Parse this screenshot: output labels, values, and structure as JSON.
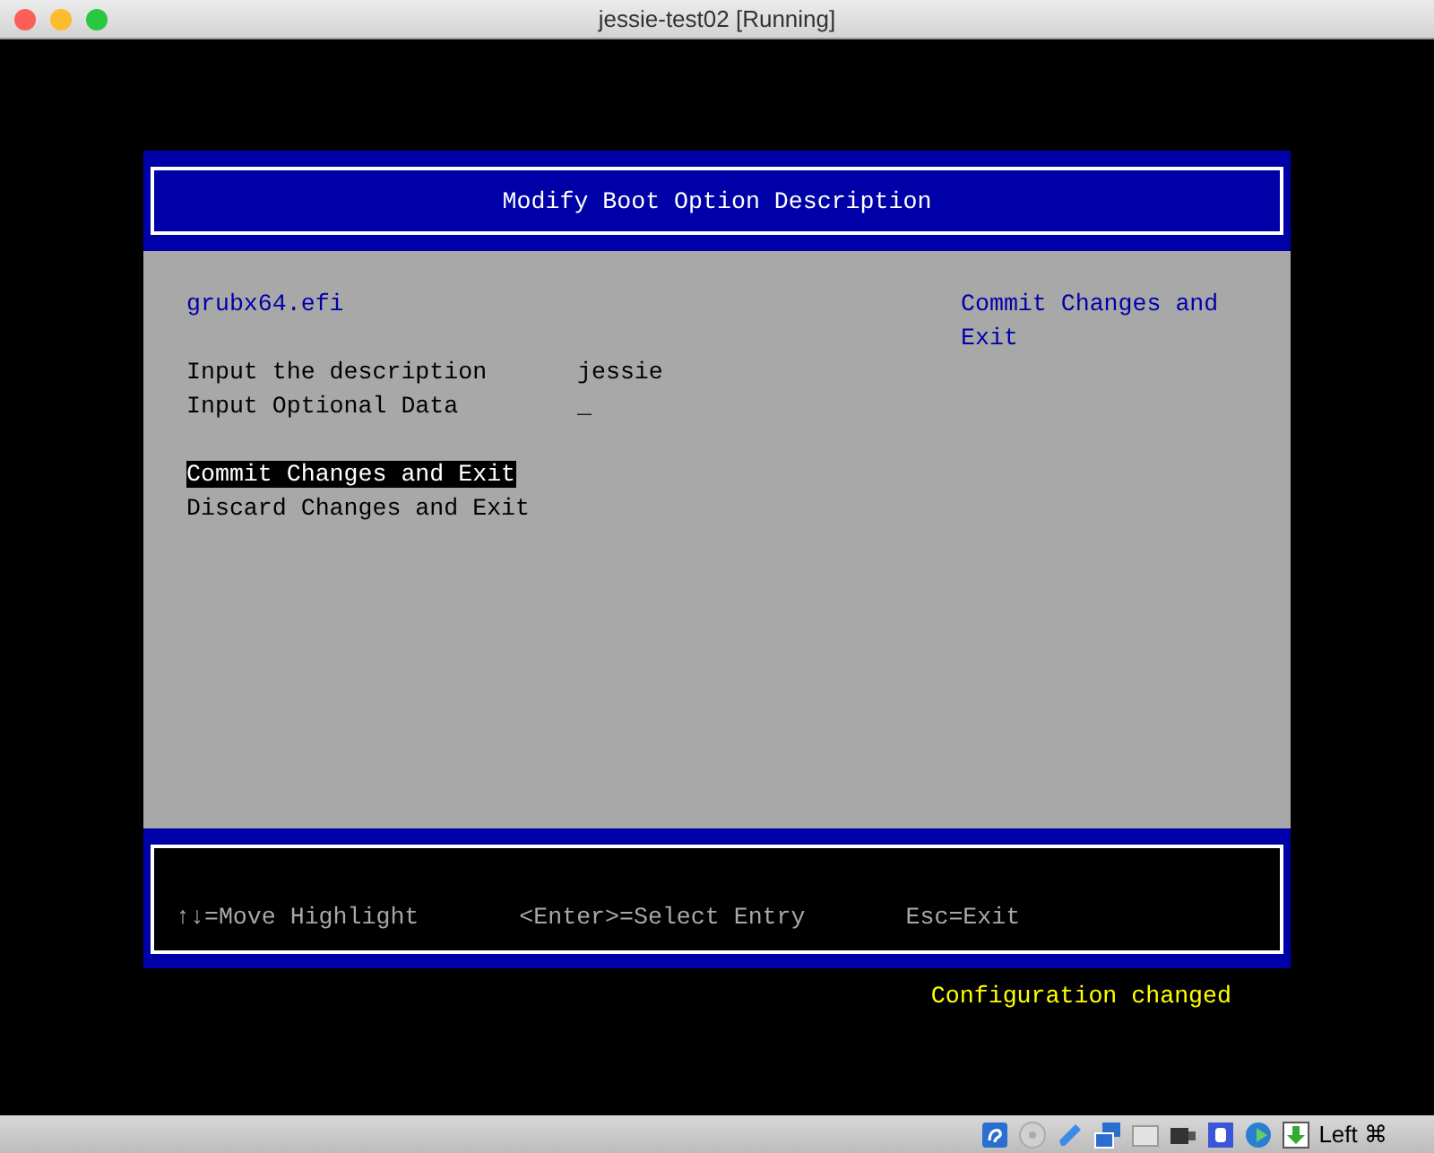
{
  "window": {
    "title": "jessie-test02 [Running]"
  },
  "header": {
    "title": "Modify Boot Option Description"
  },
  "file_name": "grubx64.efi",
  "fields": [
    {
      "label": "Input the description",
      "value": "jessie"
    },
    {
      "label": "Input Optional Data",
      "value": "_"
    }
  ],
  "menu": [
    {
      "label": "Commit Changes and Exit",
      "selected": true
    },
    {
      "label": "Discard Changes and Exit",
      "selected": false
    }
  ],
  "help_text": "Commit Changes and Exit",
  "footer": {
    "hints": [
      "↑↓=Move Highlight",
      "<Enter>=Select Entry",
      "Esc=Exit"
    ]
  },
  "status_message": "Configuration changed",
  "status_bar": {
    "host_key": "Left ⌘"
  }
}
